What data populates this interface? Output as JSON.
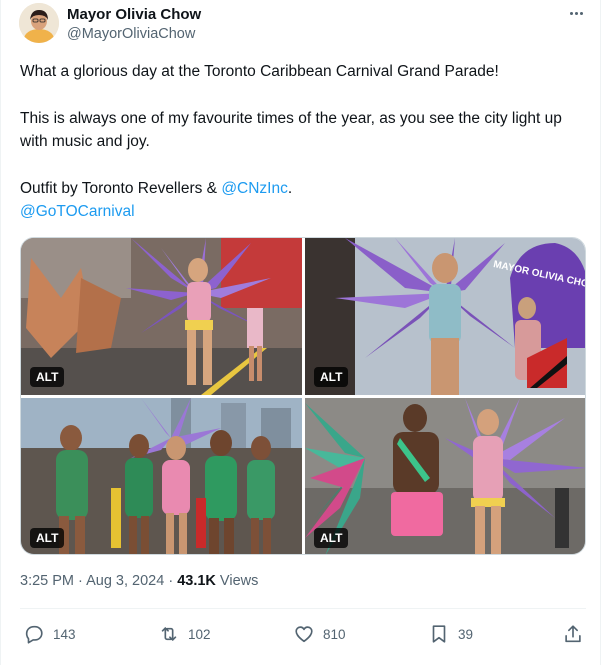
{
  "author": {
    "name": "Mayor Olivia Chow",
    "handle": "@MayorOliviaChow"
  },
  "tweet": {
    "line1": "What a glorious day at the Toronto Caribbean Carnival Grand Parade!",
    "line2": "This is always one of my favourite times of the year, as you see the city light up with music and joy.",
    "line3_prefix": "Outfit by Toronto Revellers & ",
    "mention": "@CNzInc",
    "line3_suffix": ".",
    "link": "@GoTOCarnival"
  },
  "media": {
    "alt_label": "ALT",
    "banner_text": "MAYOR OLIVIA CHOW",
    "photos": [
      {
        "alt": "ALT"
      },
      {
        "alt": "ALT"
      },
      {
        "alt": "ALT"
      },
      {
        "alt": "ALT"
      }
    ]
  },
  "meta": {
    "time": "3:25 PM",
    "separator": " · ",
    "date": "Aug 3, 2024",
    "views_count": "43.1K",
    "views_label": " Views"
  },
  "actions": {
    "replies": "143",
    "reposts": "102",
    "likes": "810",
    "bookmarks": "39"
  },
  "colors": {
    "link": "#1d9bf0",
    "secondary_text": "#536471",
    "primary_text": "#0f1419",
    "purple_feathers": "#8a5fc9",
    "pink_costume": "#e98ab0",
    "green_costume": "#2e8b57"
  }
}
